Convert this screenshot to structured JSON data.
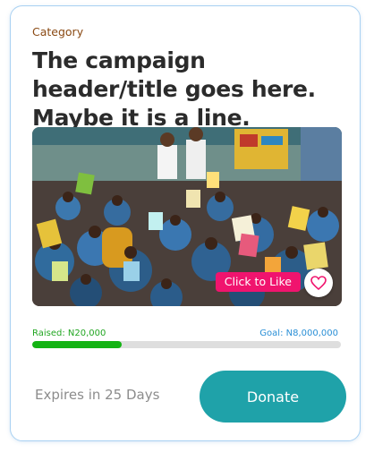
{
  "card": {
    "category": "Category",
    "title": "The campaign header/title goes here. Maybe it is a line.",
    "image": {
      "like_label": "Click to Like",
      "like_icon": "heart-outline-icon",
      "like_accent": "#f0146e"
    },
    "funding": {
      "raised_label": "Raised: N20,000",
      "goal_label": "Goal: N8,000,000",
      "progress_fraction": 0.29,
      "progress_color": "#13b313"
    },
    "footer": {
      "expires_text": "Expires in 25 Days",
      "donate_label": "Donate",
      "donate_color": "#1fa2a9"
    }
  }
}
